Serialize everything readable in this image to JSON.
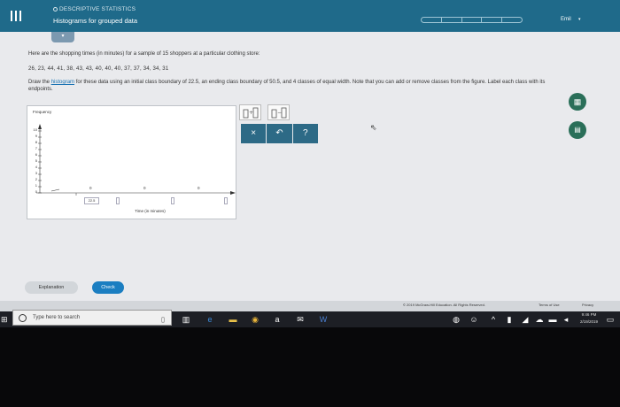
{
  "header": {
    "section_label": "DESCRIPTIVE STATISTICS",
    "topic_title": "Histograms for grouped data",
    "user_name": "Emil",
    "user_caret": "▾",
    "collapse_caret": "▾"
  },
  "question": {
    "line1": "Here are the shopping times (in minutes) for a sample of 15 shoppers at a particular clothing store:",
    "data_values": "26, 23, 44, 41, 38, 43, 43, 40, 40, 40, 37, 37, 34, 34, 31",
    "instr_pre": "Draw the ",
    "instr_link": "histogram",
    "instr_post": " for these data using an initial class boundary of 22.5, an ending class boundary of 50.5, and 4 classes of equal width. Note that you can add or remove classes from the figure. Label each class with its endpoints."
  },
  "graph": {
    "y_axis_title": "Frequency",
    "x_axis_title": "Time (in minutes)",
    "y_ticks": [
      "10",
      "9",
      "8",
      "7",
      "6",
      "5",
      "4",
      "3",
      "2",
      "1",
      "0"
    ],
    "class_counts": [
      "0",
      "0",
      "0"
    ],
    "first_boundary": "22.5"
  },
  "tools": {
    "clear_label": "×",
    "undo_label": "↶",
    "help_label": "?"
  },
  "side_icons": {
    "calculator": "calculator-icon",
    "reference": "reference-icon"
  },
  "bottom": {
    "explanation_label": "Explanation",
    "check_label": "Check",
    "copyright": "© 2019 McGraw-Hill Education. All Rights Reserved.",
    "terms": "Terms of Use",
    "privacy": "Privacy"
  },
  "taskbar": {
    "search_placeholder": "Type here to search",
    "time": "9:46 PM",
    "date": "2/19/2019"
  },
  "colors": {
    "header_bg": "#1f6a8a",
    "button_bg": "#2d6a86",
    "check_bg": "#1b7ec1",
    "side_icon_bg": "#2a6f59"
  }
}
